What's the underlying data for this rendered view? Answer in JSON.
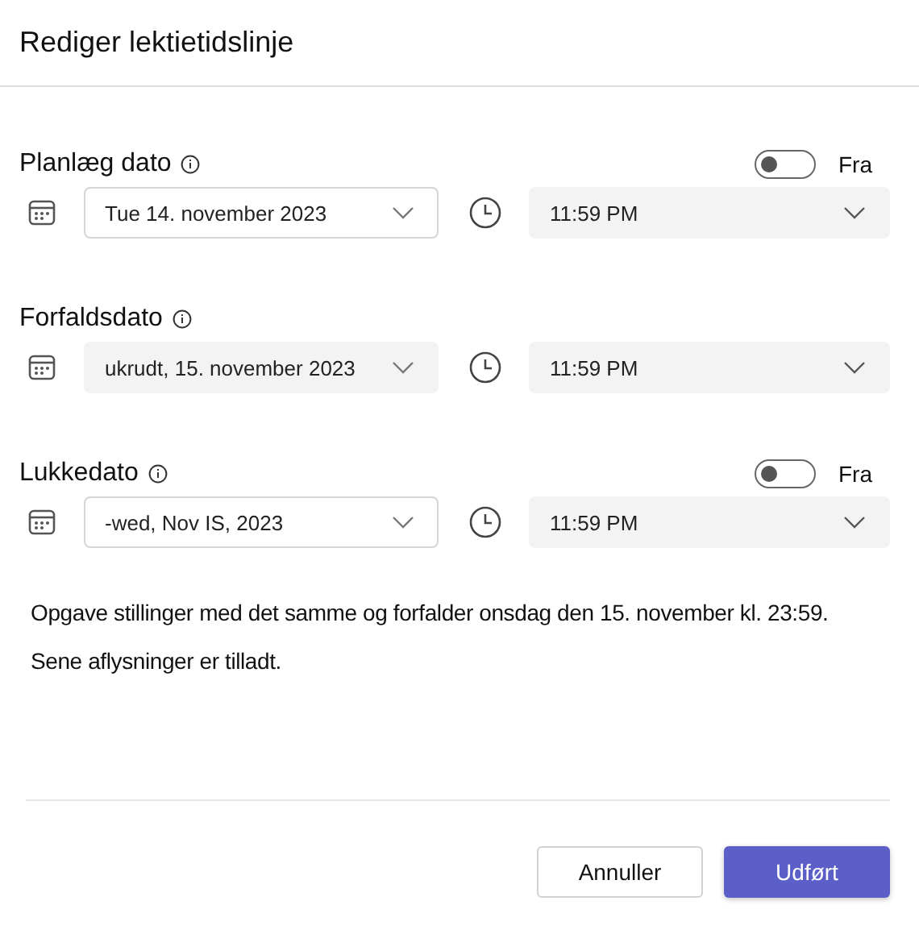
{
  "dialog": {
    "title": "Rediger lektietidslinje"
  },
  "rows": [
    {
      "label": "Planlæg dato",
      "toggle": {
        "on": false,
        "label": "Fra"
      },
      "date": {
        "value": "Tue 14. november 2023",
        "disabled": true
      },
      "time": {
        "value": "11:59 PM"
      }
    },
    {
      "label": "Forfaldsdato",
      "date": {
        "value": "ukrudt, 15. november 2023",
        "disabled": false
      },
      "time": {
        "value": "11:59 PM"
      }
    },
    {
      "label": "Lukkedato",
      "toggle": {
        "on": false,
        "label": "Fra"
      },
      "date": {
        "value": "-wed, Nov IS, 2023",
        "disabled": true
      },
      "time": {
        "value": "11:59 PM"
      }
    }
  ],
  "summary": [
    "Opgave stillinger med det samme og forfalder onsdag den 15. november kl. 23:59.",
    "Sene aflysninger er tilladt."
  ],
  "buttons": {
    "cancel": "Annuller",
    "done": "Udført"
  }
}
